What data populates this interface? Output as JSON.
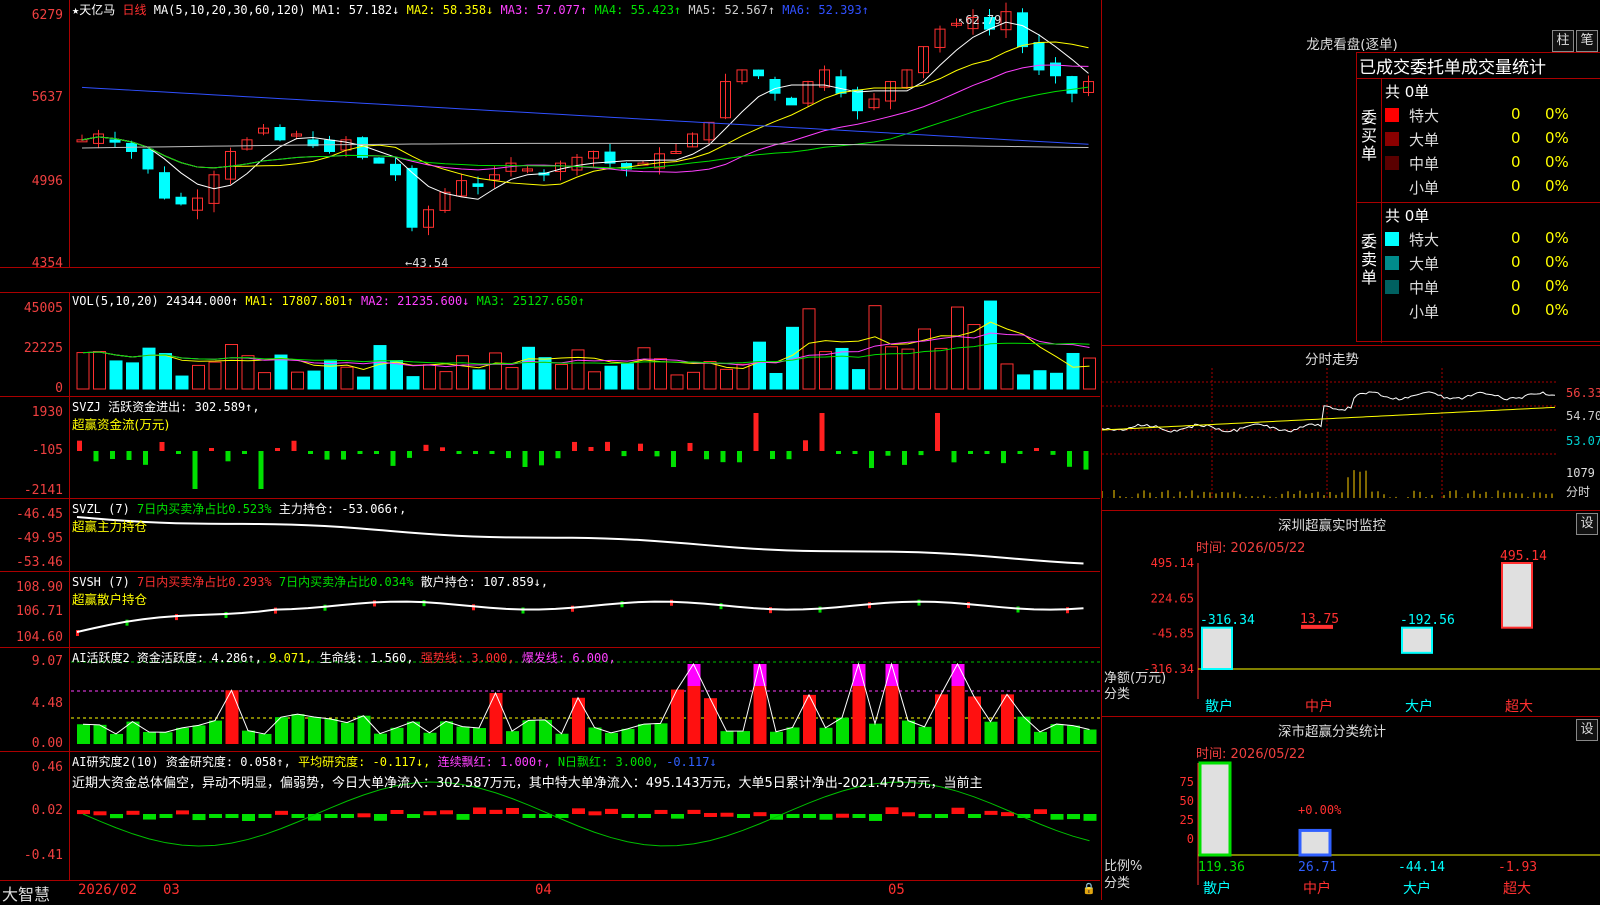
{
  "main": {
    "stock_name": "★天亿马",
    "period": "日线",
    "ma_label": "MA(5,10,20,30,60,120)",
    "ma": [
      {
        "name": "MA1:",
        "value": "57.182↓",
        "color": "#ffffff"
      },
      {
        "name": "MA2:",
        "value": "58.358↓",
        "color": "#ffff00"
      },
      {
        "name": "MA3:",
        "value": "57.077↑",
        "color": "#ff40ff"
      },
      {
        "name": "MA4:",
        "value": "55.423↑",
        "color": "#00e000"
      },
      {
        "name": "MA5:",
        "value": "52.567↑",
        "color": "#d0d0d0"
      },
      {
        "name": "MA6:",
        "value": "52.393↑",
        "color": "#3050ff"
      }
    ],
    "y_ticks": [
      "6279",
      "5637",
      "4996",
      "4354"
    ],
    "high_marker": "62.79",
    "low_marker": "43.54"
  },
  "volume": {
    "label": "VOL(5,10,20)",
    "value": "24344.000↑",
    "ma1": "MA1: 17807.801↑",
    "ma2": "MA2: 21235.600↓",
    "ma3": "MA3: 25127.650↑",
    "y_ticks": [
      "45005",
      "22225",
      "0"
    ]
  },
  "svzj": {
    "label": "SVZJ",
    "text": "活跃资金进出: 302.589↑,",
    "sub": "超赢资金流(万元)",
    "y_ticks": [
      "1930",
      "-105",
      "-2141"
    ]
  },
  "svzl": {
    "label": "SVZL (7)",
    "text1": "7日内买卖净占比0.523%",
    "text2": "主力持仓: -53.066↑,",
    "sub": "超赢主力持仓",
    "y_ticks": [
      "-46.45",
      "-49.95",
      "-53.46"
    ]
  },
  "svsh": {
    "label": "SVSH (7)",
    "text1": "7日内买卖净占比0.293%",
    "text2": "7日内买卖净占比0.034%",
    "text3": "散户持仓: 107.859↓,",
    "sub": "超赢散户持仓",
    "y_ticks": [
      "108.90",
      "106.71",
      "104.60"
    ]
  },
  "ai_active": {
    "label": "AI活跃度2",
    "text1": "资金活跃度: 4.286↑,",
    "text2": "9.071,",
    "text3": "生命线: 1.560,",
    "text4": "强势线: 3.000,",
    "text5": "爆发线: 6.000,",
    "y_ticks": [
      "9.07",
      "4.48",
      "0.00"
    ]
  },
  "ai_research": {
    "label": "AI研究度2(10)",
    "text1": "资金研究度: 0.058↑,",
    "text2": "平均研究度: -0.117↓,",
    "text3": "连续飘红: 1.000↑,",
    "text4": "N日飘红: 3.000,",
    "text5": "-0.117↓",
    "comment": "近期大资金总体偏空，异动不明显，偏弱势，今日大单净流入：302.587万元，其中特大单净流入：495.143万元，大单5日累计净出-2021.475万元，当前主",
    "y_ticks": [
      "0.46",
      "0.02",
      "-0.41"
    ]
  },
  "bottom": {
    "brand": "大智慧",
    "dates": [
      "2026/02",
      "03",
      "04",
      "05"
    ]
  },
  "right": {
    "lhb_title": "龙虎看盘(逐单)",
    "btn_zhu": "柱",
    "btn_bi": "笔",
    "tabs_title": "已成交委托单成交量统计",
    "buy_label": "委买单",
    "sell_label": "委卖单",
    "buy_total": "共 0单",
    "sell_total": "共 0单",
    "buy_rows": [
      {
        "name": "特大",
        "count": "0",
        "pct": "0%",
        "color": "#ff0000"
      },
      {
        "name": "大单",
        "count": "0",
        "pct": "0%",
        "color": "#8b0000"
      },
      {
        "name": "中单",
        "count": "0",
        "pct": "0%",
        "color": "#5a0000"
      },
      {
        "name": "小单",
        "count": "0",
        "pct": "0%",
        "color": "#000000"
      }
    ],
    "sell_rows": [
      {
        "name": "特大",
        "count": "0",
        "pct": "0%",
        "color": "#00ffff"
      },
      {
        "name": "大单",
        "count": "0",
        "pct": "0%",
        "color": "#008b8b"
      },
      {
        "name": "中单",
        "count": "0",
        "pct": "0%",
        "color": "#006060"
      },
      {
        "name": "小单",
        "count": "0",
        "pct": "0%",
        "color": "#000000"
      }
    ],
    "intraday_title": "分时走势",
    "intraday_prices": [
      "56.33",
      "54.70",
      "53.07"
    ],
    "intraday_vol": "1079",
    "intraday_vol_label": "分时",
    "sz_title": "深圳超赢实时监控",
    "sz_btn": "设",
    "sz_time": "时间: 2026/05/22",
    "sz_y_ticks": [
      "495.14",
      "224.65",
      "-45.85",
      "-316.34"
    ],
    "sz_unit": "净额(万元)",
    "sz_cat": "分类",
    "sz_categories": [
      "散户",
      "中户",
      "大户",
      "超大"
    ],
    "sz_values": [
      "-316.34",
      "13.75",
      "-192.56",
      "495.14"
    ],
    "cls_title": "深市超赢分类统计",
    "cls_btn": "设",
    "cls_time": "时间: 2026/05/22",
    "cls_y_ticks": [
      "75",
      "50",
      "25",
      "0"
    ],
    "cls_unit": "比例%",
    "cls_cat": "分类",
    "cls_categories": [
      "散户",
      "中户",
      "大户",
      "超大"
    ],
    "cls_values": [
      "119.36",
      "26.71",
      "-44.14",
      "-1.93"
    ],
    "cls_top_label": "+0.00%"
  },
  "chart_data": [
    {
      "type": "bar",
      "title": "深圳超赢实时监控",
      "categories": [
        "散户",
        "中户",
        "大户",
        "超大"
      ],
      "values": [
        -316.34,
        13.75,
        -192.56,
        495.14
      ],
      "ylabel": "净额(万元)",
      "ylim": [
        -316.34,
        495.14
      ]
    },
    {
      "type": "bar",
      "title": "深市超赢分类统计",
      "categories": [
        "散户",
        "中户",
        "大户",
        "超大"
      ],
      "values": [
        119.36,
        26.71,
        -44.14,
        -1.93
      ],
      "ylabel": "比例%",
      "ylim": [
        0,
        100
      ]
    }
  ]
}
